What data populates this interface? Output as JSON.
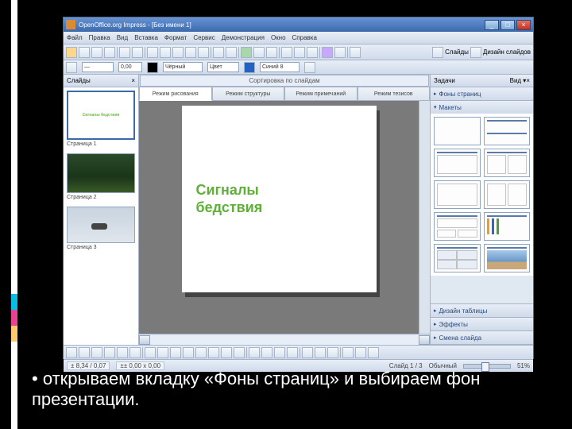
{
  "window": {
    "title": "OpenOffice.org Impress - [Без имени 1]"
  },
  "winbuttons": {
    "min": "_",
    "max": "□",
    "close": "×"
  },
  "menu": [
    "Файл",
    "Правка",
    "Вид",
    "Вставка",
    "Формат",
    "Сервис",
    "Демонстрация",
    "Окно",
    "Справка"
  ],
  "toolbar2": {
    "black": "Чёрный",
    "color": "Цвет",
    "blue": "Синий 8"
  },
  "panels": {
    "slides_title": "Слайды",
    "tasks_title": "Задачи",
    "view_label": "Вид ▾"
  },
  "slides": [
    {
      "label": "Страница 1",
      "text": "Сигналы\nбедствия"
    },
    {
      "label": "Страница 2",
      "text": ""
    },
    {
      "label": "Страница 3",
      "text": ""
    }
  ],
  "main": {
    "label_row": "Сортировка по слайдам",
    "tabs": [
      "Режим рисования",
      "Режим структуры",
      "Режим примечаний",
      "Режим тезисов"
    ],
    "slide_text_l1": "Сигналы",
    "slide_text_l2": "бедствия"
  },
  "tasks": {
    "sections": [
      "Фоны страниц",
      "Макеты",
      "Дизайн таблицы",
      "Эффекты",
      "Смена слайда"
    ]
  },
  "right_toolbar": {
    "slides": "Слайды",
    "design": "Дизайн слайдов"
  },
  "status": {
    "pos": "± 8,34 / 0,07",
    "size": "±± 0,00 x 0,00",
    "slide": "Слайд 1 / 3",
    "layout": "Обычный",
    "zoom": "51%"
  },
  "caption": "•  открываем вкладку «Фоны страниц» и выбираем фон презентации."
}
